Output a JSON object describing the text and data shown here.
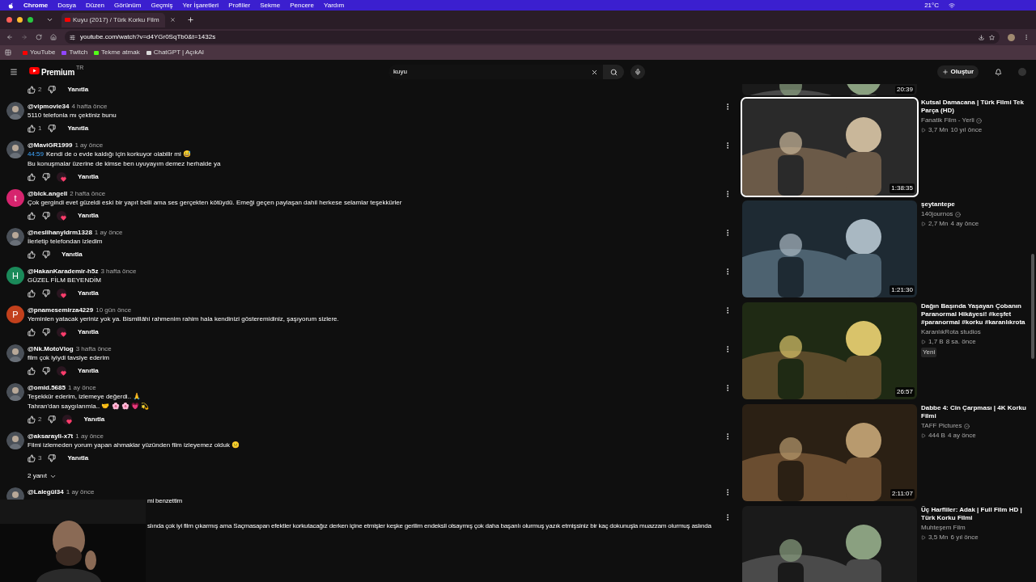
{
  "menubar": {
    "app": "Chrome",
    "items": [
      "Dosya",
      "Düzen",
      "Görünüm",
      "Geçmiş",
      "Yer İşaretleri",
      "Profiller",
      "Sekme",
      "Pencere",
      "Yardım"
    ],
    "weather": "21°C"
  },
  "tab": {
    "title": "Kuyu (2017) / Türk Korku Film"
  },
  "address": {
    "url": "youtube.com/watch?v=d4YGr0SqTb0&t=1432s"
  },
  "bookmarks": [
    {
      "label": "YouTube",
      "color": "#ff0000"
    },
    {
      "label": "Twitch",
      "color": "#9146ff"
    },
    {
      "label": "Tekme atmak",
      "color": "#53fc18"
    },
    {
      "label": "ChatGPT | AçıkAI",
      "color": "#d9d9d9"
    }
  ],
  "header": {
    "logo": "Premium",
    "region": "TR",
    "search_value": "kuyu",
    "create": "Oluştur"
  },
  "top_comment_actions": {
    "likes": "2",
    "reply": "Yanıtla"
  },
  "comments": [
    {
      "author": "@vipmovie34",
      "time": "4 hafta önce",
      "lines": [
        "5110 telefonla mı çektiniz bunu"
      ],
      "likes": "1",
      "creator_heart": false,
      "reply": "Yanıtla",
      "avatar": {
        "kind": "picture"
      }
    },
    {
      "author": "@MaviGR1999",
      "time": "1 ay önce",
      "timestamp": "44:59",
      "lines": [
        "Kendi de o evde kaldığı için korkuyor olabilir mi 😅",
        "Bu konuşmalar üzerine de kimse ben uyuyayım demez herhalde ya"
      ],
      "creator_heart": true,
      "reply": "Yanıtla",
      "avatar": {
        "kind": "picture"
      }
    },
    {
      "author": "@blck.angell",
      "time": "2 hafta önce",
      "lines": [
        "Çok gergindi evet güzeldi eski bir yapıt belli ama ses gerçekten kötüydü. Emeği geçen paylaşan dahil herkese selamlar teşekkürler"
      ],
      "creator_heart": true,
      "reply": "Yanıtla",
      "avatar": {
        "kind": "letter",
        "letter": "t",
        "color": "#d6246e"
      }
    },
    {
      "author": "@neslihanyldrm1328",
      "time": "1 ay önce",
      "lines": [
        "İlerletip telefondan izledim"
      ],
      "creator_heart": false,
      "reply": "Yanıtla",
      "avatar": {
        "kind": "picture"
      }
    },
    {
      "author": "@HakanKarademir-h5z",
      "time": "3 hafta önce",
      "lines": [
        "GÜZEL FİLM BEYENDİM"
      ],
      "creator_heart": true,
      "reply": "Yanıtla",
      "avatar": {
        "kind": "letter",
        "letter": "H",
        "color": "#1b8a5a"
      }
    },
    {
      "author": "@pnamesemirza4229",
      "time": "10 gün önce",
      "lines": [
        "Yeminlen yatacak yeriniz yok ya. Bismillâhi rahmenim rahim  hala kendinizi gösteremidiniz, şaşıyorum sizlere."
      ],
      "creator_heart": true,
      "reply": "Yanıtla",
      "avatar": {
        "kind": "letter",
        "letter": "P",
        "color": "#c2401c"
      }
    },
    {
      "author": "@Nk.MotoVlog",
      "time": "3 hafta önce",
      "lines": [
        "film çok iyiydi tavsiye ederim"
      ],
      "creator_heart": true,
      "reply": "Yanıtla",
      "avatar": {
        "kind": "picture"
      }
    },
    {
      "author": "@omid.5685",
      "time": "1 ay önce",
      "lines": [
        "Teşekkür ederim, izlemeye değerdi.. 🙏",
        "Tahran'dan saygılarımla.. 🤝 🌸 🌸 💗 💫"
      ],
      "likes": "2",
      "creator_heart": true,
      "reply": "Yanıtla",
      "avatar": {
        "kind": "picture"
      }
    },
    {
      "author": "@aksarayli-x7t",
      "time": "1 ay önce",
      "lines": [
        "Filmi izlemeden yorum yapan ahmaklar yüzünden film izleyemez olduk 😑"
      ],
      "likes": "3",
      "creator_heart": false,
      "reply": "Yanıtla",
      "replies": "2 yanıt",
      "avatar": {
        "kind": "picture"
      }
    },
    {
      "author": "@Lalegül34",
      "time": "1 ay önce",
      "lines": [
        "mi benzettim"
      ],
      "clipped": true,
      "avatar": {
        "kind": "picture"
      }
    },
    {
      "lines": [
        "slında çok iyi film çıkarmış ama Saçmasapan efektler korkutacağız  derken içine etmişler keşke gerilim endeksli olsaymış çok daha başarılı olurmuş yazık etmişsiniz bir kaç dokunuşla muazzam olurmuş aslında"
      ],
      "clipped": true
    }
  ],
  "top_video": {
    "duration": "20:39"
  },
  "videos": [
    {
      "title": "Kutsal Damacana | Türk Filmi Tek Parça (HD)",
      "channel": "Fanatik Film - Yerli",
      "verified": true,
      "views": "3,7 Mn",
      "age": "10 yıl önce",
      "duration": "1:38:35",
      "highlighted": true
    },
    {
      "title": "şeytantepe",
      "channel": "140journos",
      "verified": true,
      "views": "2,7 Mn",
      "age": "4 ay önce",
      "duration": "1:21:30",
      "highlighted": false
    },
    {
      "title": "Dağın Başında Yaşayan Çobanın Paranormal Hikâyesi! #keşfet #paranormal #korku #karanlıkrota",
      "channel": "KaranlıkRota studios",
      "verified": false,
      "views": "1,7 B",
      "age": "8 sa. önce",
      "badge": "Yeni",
      "duration": "26:57",
      "highlighted": false
    },
    {
      "title": "Dabbe 4: Cin Çarpması | 4K Korku Filmi",
      "channel": "TAFF Pictures",
      "verified": true,
      "views": "444 B",
      "age": "4 ay önce",
      "duration": "2:11:07",
      "highlighted": false
    },
    {
      "title": "Üç Harfliler: Adak | Full Film HD | Türk Korku Filmi",
      "channel": "Muhteşem Film",
      "verified": false,
      "views": "3,5 Mn",
      "age": "6 yıl önce",
      "highlighted": false
    }
  ]
}
